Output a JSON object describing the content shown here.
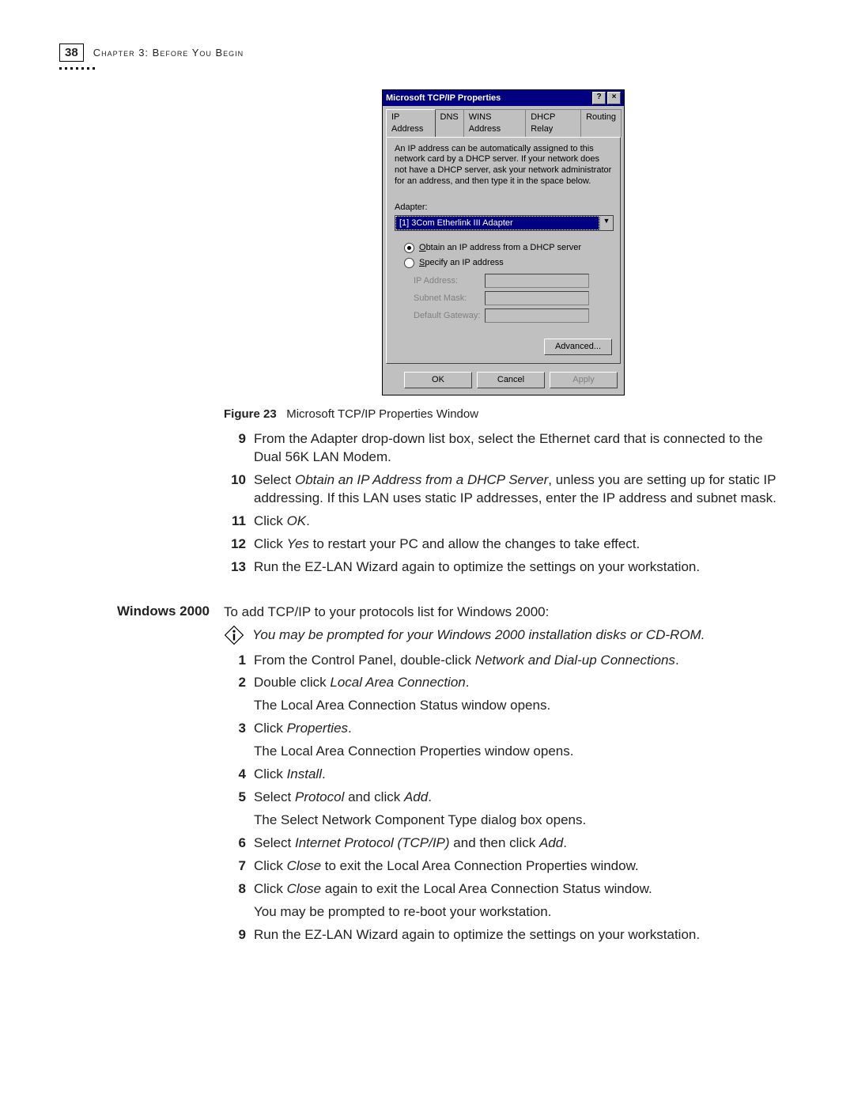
{
  "header": {
    "page_number": "38",
    "chapter_label": "Chapter 3: Before You Begin"
  },
  "dialog": {
    "title": "Microsoft TCP/IP Properties",
    "help_glyph": "?",
    "close_glyph": "×",
    "tabs": {
      "ip": "IP Address",
      "dns": "DNS",
      "wins": "WINS Address",
      "dhcp": "DHCP Relay",
      "routing": "Routing"
    },
    "desc": "An IP address can be automatically assigned to this network card by a DHCP server. If your network does not have a DHCP server, ask your network administrator for an address, and then type it in the space below.",
    "adapter_label": "Adapter:",
    "adapter_value": "[1] 3Com Etherlink III Adapter",
    "radio_obtain": "Obtain an IP address from a DHCP server",
    "radio_specify": "Specify an IP address",
    "ip_label": "IP Address:",
    "subnet_label": "Subnet Mask:",
    "gateway_label": "Default Gateway:",
    "advanced": "Advanced...",
    "ok": "OK",
    "cancel": "Cancel",
    "apply": "Apply"
  },
  "figure": {
    "label": "Figure 23",
    "caption": "Microsoft TCP/IP Properties Window"
  },
  "list1": {
    "n9": "9",
    "t9": "From the Adapter drop-down list box, select the Ethernet card that is connected to the Dual 56K LAN Modem.",
    "n10": "10",
    "t10a": "Select ",
    "t10i": "Obtain an IP Address from a DHCP Server",
    "t10b": ", unless you are setting up for static IP addressing. If this LAN uses static IP addresses, enter the IP address and subnet mask.",
    "n11": "11",
    "t11a": "Click ",
    "t11i": "OK",
    "t11b": ".",
    "n12": "12",
    "t12a": "Click ",
    "t12i": "Yes",
    "t12b": " to restart your PC and allow the changes to take effect.",
    "n13": "13",
    "t13": "Run the EZ-LAN Wizard again to optimize the settings on your workstation."
  },
  "win2000": {
    "heading": "Windows 2000",
    "intro": "To add TCP/IP to your protocols list for Windows 2000:",
    "note": "You may be prompted for your Windows 2000 installation disks or CD-ROM."
  },
  "list2": {
    "n1": "1",
    "t1a": "From the Control Panel, double-click ",
    "t1i": "Network and Dial-up Connections",
    "t1b": ".",
    "n2": "2",
    "t2a": "Double click ",
    "t2i": "Local Area Connection",
    "t2b": ".",
    "t2s": "The Local Area Connection Status window opens.",
    "n3": "3",
    "t3a": "Click ",
    "t3i": "Properties",
    "t3b": ".",
    "t3s": "The Local Area Connection Properties window opens.",
    "n4": "4",
    "t4a": "Click ",
    "t4i": "Install",
    "t4b": ".",
    "n5": "5",
    "t5a": "Select ",
    "t5i": "Protocol",
    "t5b": " and click ",
    "t5i2": "Add",
    "t5c": ".",
    "t5s": "The Select Network Component Type dialog box opens.",
    "n6": "6",
    "t6a": "Select ",
    "t6i": "Internet Protocol (TCP/IP)",
    "t6b": " and then click ",
    "t6i2": "Add",
    "t6c": ".",
    "n7": "7",
    "t7a": "Click ",
    "t7i": "Close",
    "t7b": " to exit the Local Area Connection Properties window.",
    "n8": "8",
    "t8a": "Click ",
    "t8i": "Close",
    "t8b": " again to exit the Local Area Connection Status window.",
    "t8s": "You may be prompted to re-boot your workstation.",
    "n9": "9",
    "t9": "Run the EZ-LAN Wizard again to optimize the settings on your workstation."
  }
}
